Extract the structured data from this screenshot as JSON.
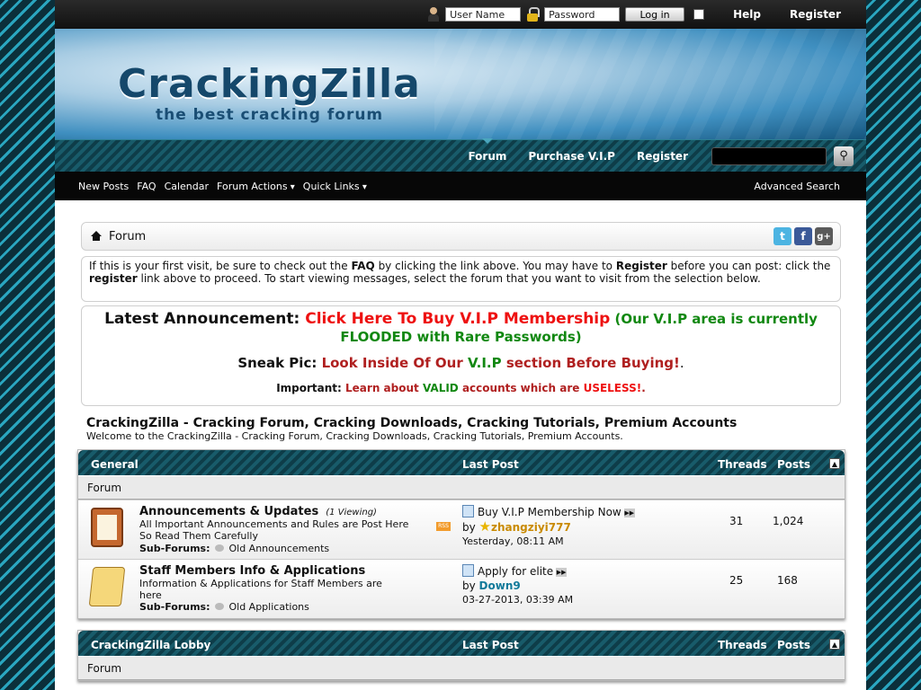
{
  "topbar": {
    "username_placeholder": "User Name",
    "password_placeholder": "Password",
    "login_label": "Log in",
    "help": "Help",
    "register": "Register"
  },
  "banner": {
    "logo": "CrackingZilla",
    "tagline": "the best cracking forum"
  },
  "nav": {
    "forum": "Forum",
    "vip": "Purchase V.I.P",
    "register": "Register"
  },
  "subnav": {
    "new_posts": "New Posts",
    "faq": "FAQ",
    "calendar": "Calendar",
    "forum_actions": "Forum Actions",
    "quick_links": "Quick Links",
    "advanced_search": "Advanced Search"
  },
  "breadcrumb": {
    "label": "Forum"
  },
  "notice": {
    "p1": "If this is your first visit, be sure to check out the ",
    "faq": "FAQ",
    "p2": " by clicking the link above. You may have to ",
    "register": "Register",
    "p3": " before you can post: click the ",
    "register2": "register",
    "p4": " link above to proceed. To start viewing messages, select the forum that you want to visit from the selection below."
  },
  "announcement": {
    "latest_label": "Latest Announcement: ",
    "latest_link": "Click Here To Buy V.I.P Membership",
    "latest_note": " (Our V.I.P area is currently FLOODED with Rare Passwords)",
    "sneak_label": "Sneak Pic: ",
    "sneak_a": "Look Inside Of Our ",
    "sneak_b": "V.I.P",
    "sneak_c": " section Before Buying!",
    "sneak_dot": ".",
    "imp_label": "Important: ",
    "imp_a": "Learn about ",
    "imp_b": "VALID",
    "imp_c": " accounts which are ",
    "imp_d": "USELESS!",
    "imp_dot": "."
  },
  "welcome": {
    "title": "CrackingZilla - Cracking Forum, Cracking Downloads, Cracking Tutorials, Premium Accounts",
    "subtitle": "Welcome to the CrackingZilla - Cracking Forum, Cracking Downloads, Cracking Tutorials, Premium Accounts."
  },
  "columns": {
    "last_post": "Last Post",
    "threads": "Threads",
    "posts": "Posts",
    "forum": "Forum"
  },
  "categories": [
    {
      "title": "General"
    },
    {
      "title": "CrackingZilla Lobby"
    }
  ],
  "forums": [
    {
      "name": "Announcements & Updates",
      "viewing": "(1 Viewing)",
      "desc": "All Important Announcements and Rules are Post Here So Read Them Carefully",
      "subforums_label": "Sub-Forums:",
      "subforum": "Old Announcements",
      "lp_title": "Buy V.I.P Membership Now",
      "lp_by": "by ",
      "lp_user": "zhangziyi777",
      "lp_date": "Yesterday, 08:11 AM",
      "threads": "31",
      "posts": "1,024"
    },
    {
      "name": "Staff Members Info & Applications",
      "desc": "Information & Applications for Staff Members are here",
      "subforums_label": "Sub-Forums:",
      "subforum": "Old Applications",
      "lp_title": "Apply for elite",
      "lp_by": "by ",
      "lp_user": "Down9",
      "lp_date": "03-27-2013, 03:39 AM",
      "threads": "25",
      "posts": "168"
    }
  ],
  "icons": {
    "user": "user-icon",
    "lock": "lock-icon",
    "search": "search-icon",
    "home": "home-icon",
    "rss": "rss-icon",
    "collapse": "collapse-icon"
  }
}
